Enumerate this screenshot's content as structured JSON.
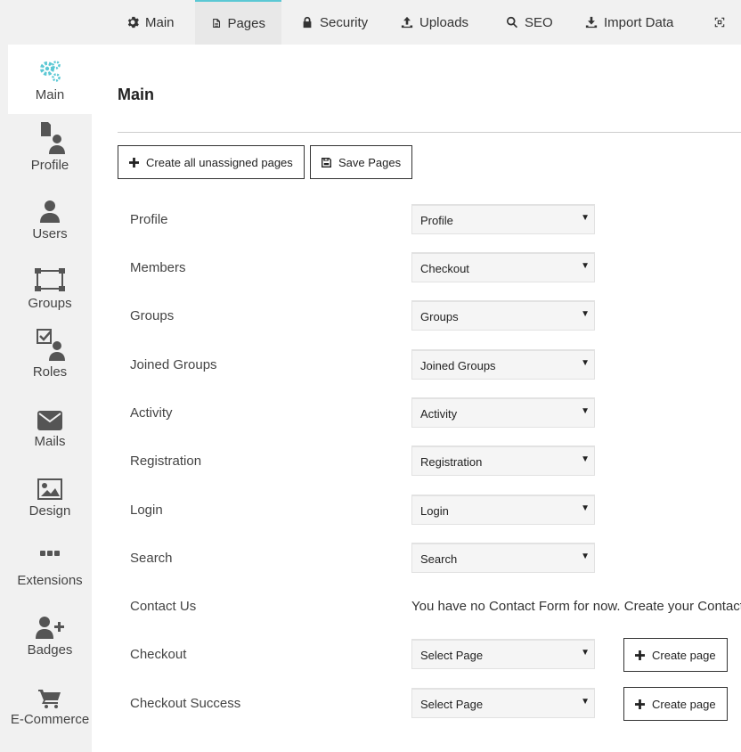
{
  "topnav": {
    "tabs": [
      {
        "label": "Main",
        "icon": "gear-icon"
      },
      {
        "label": "Pages",
        "icon": "document-icon",
        "active": true
      },
      {
        "label": "Security",
        "icon": "lock-icon"
      },
      {
        "label": "Uploads",
        "icon": "upload-icon"
      },
      {
        "label": "SEO",
        "icon": "search-icon"
      },
      {
        "label": "Import Data",
        "icon": "download-icon"
      }
    ]
  },
  "sidebar": {
    "items": [
      {
        "label": "Main",
        "icon": "gears-icon",
        "active": true
      },
      {
        "label": "Profile",
        "icon": "profile-icon"
      },
      {
        "label": "Users",
        "icon": "user-icon"
      },
      {
        "label": "Groups",
        "icon": "group-icon"
      },
      {
        "label": "Roles",
        "icon": "role-icon"
      },
      {
        "label": "Mails",
        "icon": "envelope-icon"
      },
      {
        "label": "Design",
        "icon": "image-icon"
      },
      {
        "label": "Extensions",
        "icon": "ellipsis-icon"
      },
      {
        "label": "Badges",
        "icon": "user-plus-icon"
      },
      {
        "label": "E-Commerce",
        "icon": "cart-icon"
      }
    ]
  },
  "main": {
    "title": "Main",
    "create_all_label": "Create all unassigned pages",
    "save_label": "Save Pages",
    "rows": [
      {
        "label": "Profile",
        "value": "Profile"
      },
      {
        "label": "Members",
        "value": "Checkout"
      },
      {
        "label": "Groups",
        "value": "Groups"
      },
      {
        "label": "Joined Groups",
        "value": "Joined Groups"
      },
      {
        "label": "Activity",
        "value": "Activity"
      },
      {
        "label": "Registration",
        "value": "Registration"
      },
      {
        "label": "Login",
        "value": "Login"
      },
      {
        "label": "Search",
        "value": "Search"
      },
      {
        "label": "Contact Us",
        "message": "You have no Contact Form for now. Create your Contact Fo"
      },
      {
        "label": "Checkout",
        "value": "Select Page",
        "create_label": "Create page"
      },
      {
        "label": "Checkout Success",
        "value": "Select Page",
        "create_label": "Create page"
      }
    ]
  },
  "colors": {
    "accent": "#5bc8d4",
    "sidebar_bg": "#f1f1f1"
  }
}
